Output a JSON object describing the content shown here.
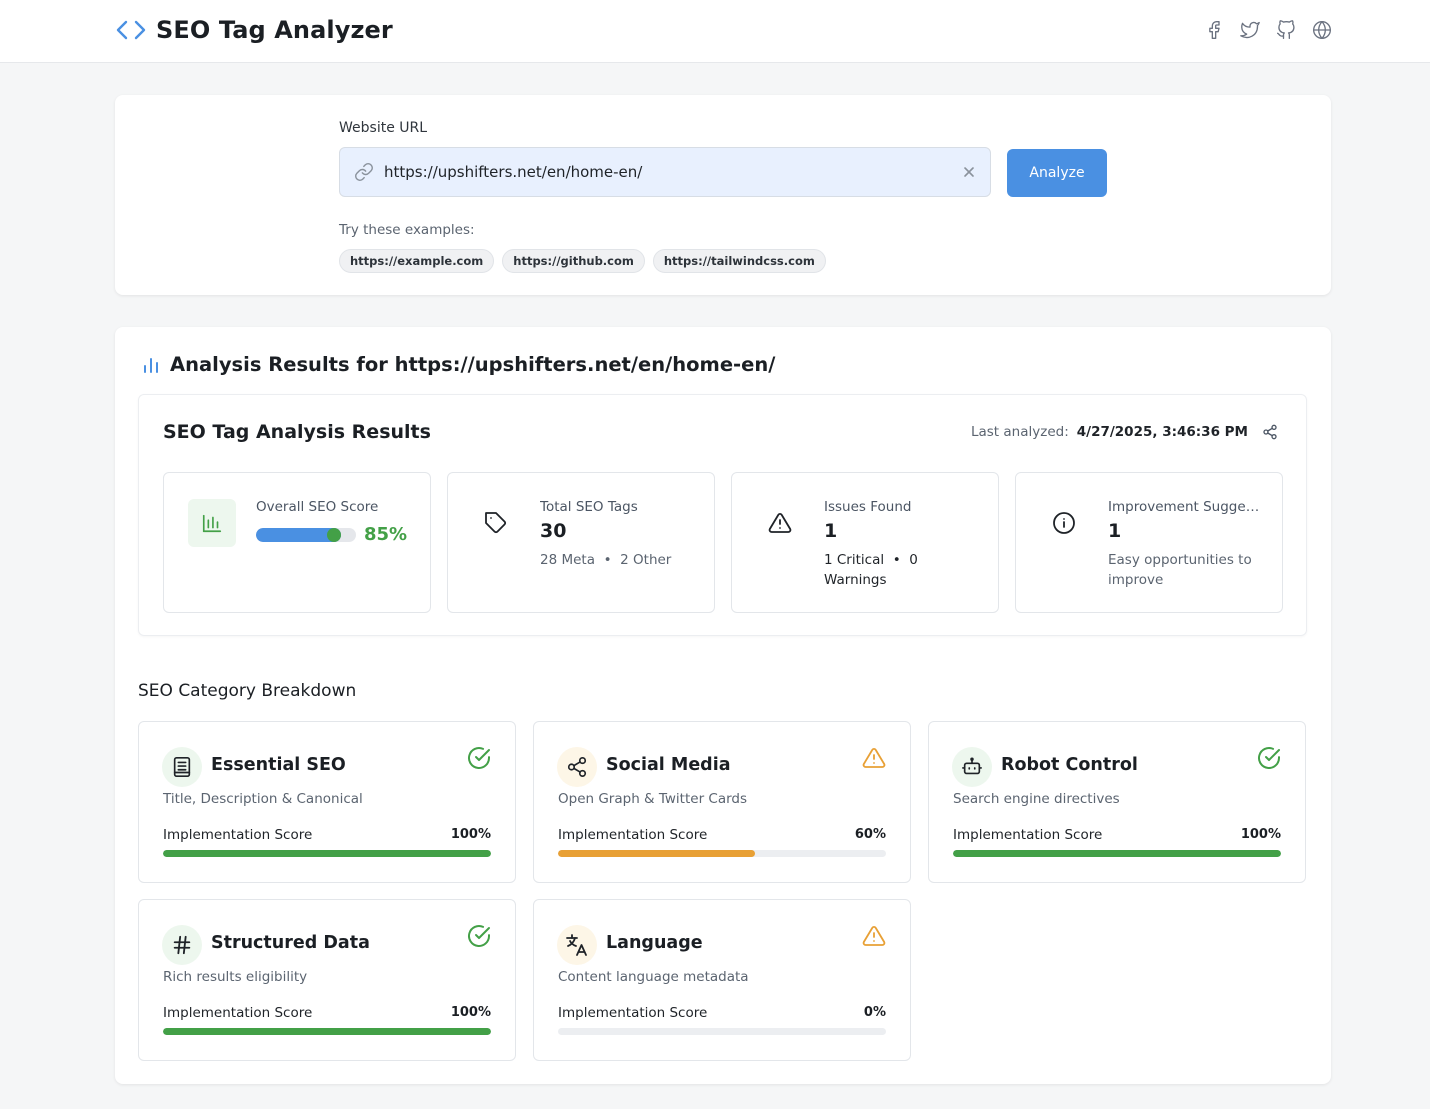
{
  "header": {
    "title": "SEO Tag Analyzer",
    "social_icons": [
      "facebook-icon",
      "twitter-icon",
      "github-icon",
      "globe-icon"
    ]
  },
  "url_form": {
    "label": "Website URL",
    "value": "https://upshifters.net/en/home-en/",
    "analyze_label": "Analyze",
    "examples_label": "Try these examples:",
    "examples": [
      "https://example.com",
      "https://github.com",
      "https://tailwindcss.com"
    ]
  },
  "results": {
    "heading": "Analysis Results for https://upshifters.net/en/home-en/",
    "panel_title": "SEO Tag Analysis Results",
    "last_analyzed_label": "Last analyzed:",
    "last_analyzed_value": "4/27/2025, 3:46:36 PM",
    "stats": {
      "score": {
        "label": "Overall SEO Score",
        "value": "85%",
        "fraction": 0.85
      },
      "tags": {
        "label": "Total SEO Tags",
        "value": "30",
        "meta": "28 Meta",
        "other": "2 Other"
      },
      "issues": {
        "label": "Issues Found",
        "value": "1",
        "critical": "1 Critical",
        "warnings": "0 Warnings"
      },
      "suggestions": {
        "label": "Improvement Suggestions",
        "value": "1",
        "sub": "Easy opportunities to improve"
      }
    }
  },
  "breakdown": {
    "title": "SEO Category Breakdown",
    "impl_label": "Implementation Score",
    "categories": [
      {
        "title": "Essential SEO",
        "desc": "Title, Description & Canonical",
        "score": "100%",
        "fraction": 1.0,
        "status": "check-circle-icon",
        "icon": "document-icon"
      },
      {
        "title": "Social Media",
        "desc": "Open Graph & Twitter Cards",
        "score": "60%",
        "fraction": 0.6,
        "status": "warning-icon",
        "icon": "share-icon"
      },
      {
        "title": "Robot Control",
        "desc": "Search engine directives",
        "score": "100%",
        "fraction": 1.0,
        "status": "check-circle-icon",
        "icon": "robot-icon"
      },
      {
        "title": "Structured Data",
        "desc": "Rich results eligibility",
        "score": "100%",
        "fraction": 1.0,
        "status": "check-circle-icon",
        "icon": "hash-icon"
      },
      {
        "title": "Language",
        "desc": "Content language metadata",
        "score": "0%",
        "fraction": 0.0,
        "status": "warning-icon",
        "icon": "translate-icon"
      }
    ]
  },
  "colors": {
    "accent": "#4a90e2",
    "success": "#43a047",
    "warning": "#e8a035"
  }
}
